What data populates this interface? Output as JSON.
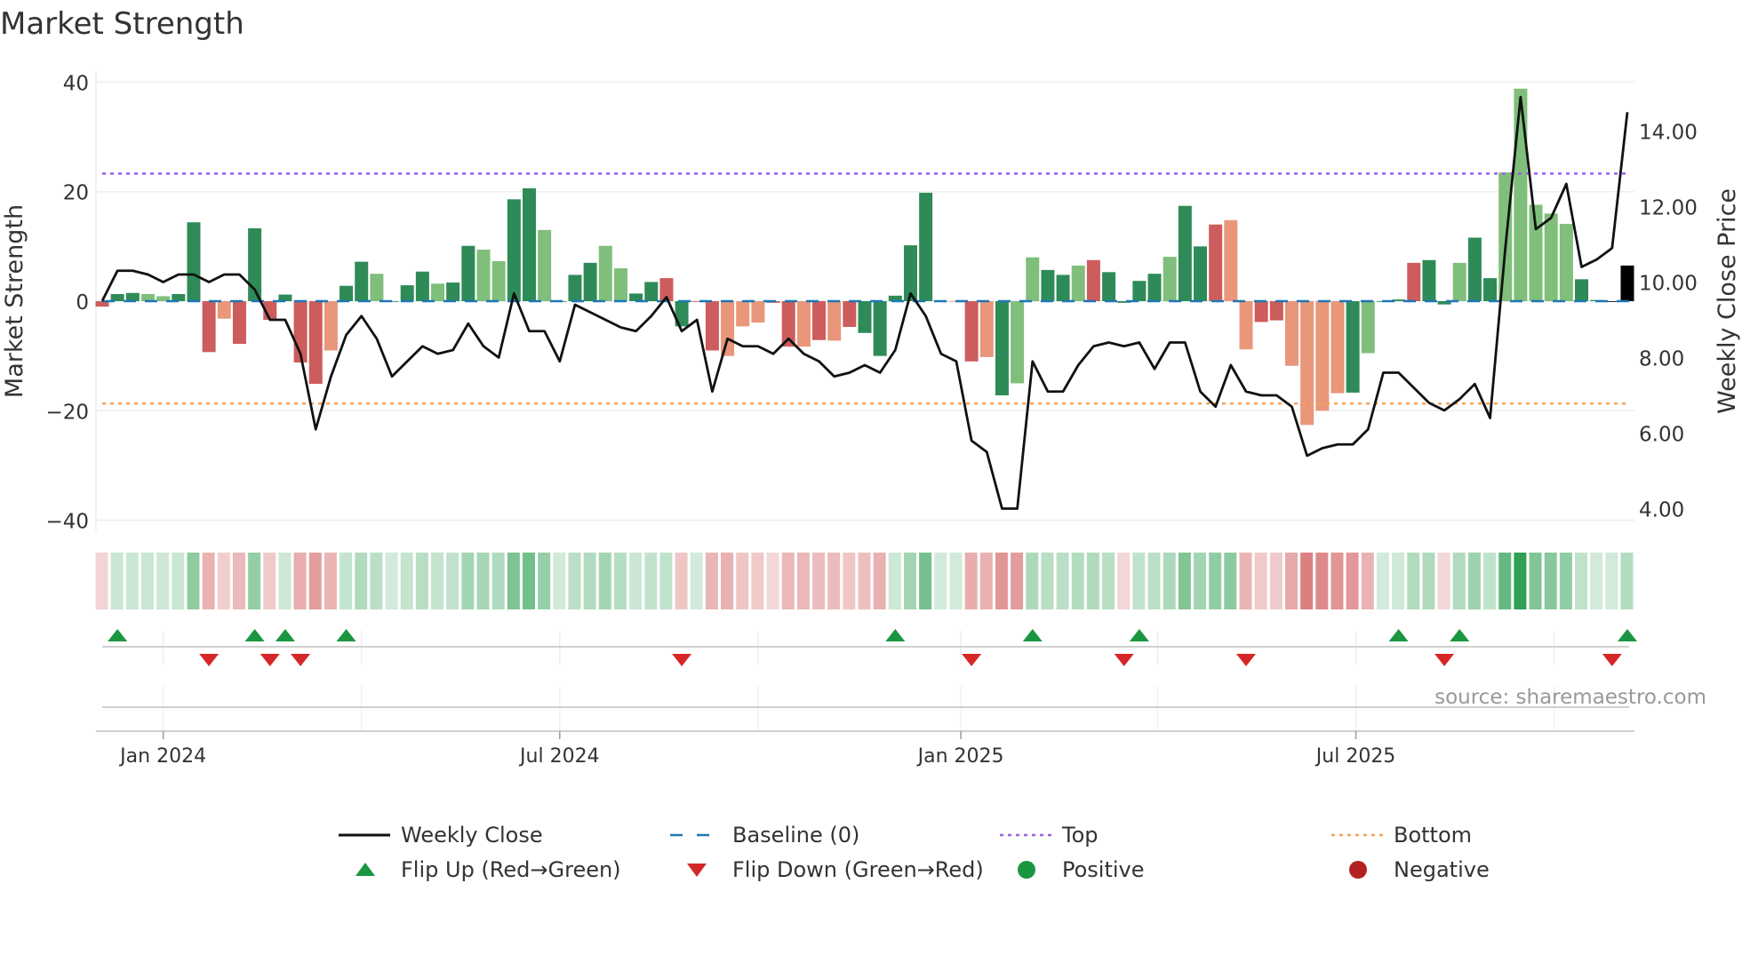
{
  "chart_data": {
    "type": "bar",
    "title": "Market Strength",
    "ylabel": "Market Strength",
    "y2label": "Weekly Close Price",
    "ylim": [
      -42,
      42
    ],
    "y2lim": [
      3.55,
      15.4
    ],
    "yticks": [
      40,
      20,
      0,
      -20,
      -40
    ],
    "yticklabels": [
      "40",
      "20",
      "0",
      "−20",
      "−40"
    ],
    "y2ticks": [
      14,
      12,
      10,
      8,
      6,
      4
    ],
    "y2ticklabels": [
      "14.00",
      "12.00",
      "10.00",
      "8.00",
      "6.00",
      "4.00"
    ],
    "xticks": [
      {
        "week": 4,
        "label": "Jan 2024"
      },
      {
        "week": 30,
        "label": "Jul 2024"
      },
      {
        "week": 56.3,
        "label": "Jan 2025"
      },
      {
        "week": 82.2,
        "label": "Jul 2025"
      }
    ],
    "quarter_gridlines_week": [
      4,
      17,
      30,
      43,
      56.3,
      69.2,
      82.2,
      95.2
    ],
    "top_level": 23.3,
    "bottom_level": -18.7,
    "baseline": 0,
    "strength": [
      -1,
      1.3,
      1.5,
      1.3,
      0.9,
      1.3,
      14.4,
      -9.3,
      -3.2,
      -7.8,
      13.3,
      -3.4,
      1.2,
      -11.2,
      -15.1,
      -9,
      2.8,
      7.2,
      5,
      0,
      2.9,
      5.4,
      3.2,
      3.4,
      10.1,
      9.4,
      7.3,
      18.6,
      20.6,
      13,
      0,
      4.8,
      7,
      10.1,
      6,
      1.4,
      3.5,
      4.2,
      -4.6,
      0,
      -9,
      -10,
      -4.6,
      -3.9,
      -0.3,
      -8.3,
      -8.3,
      -7.1,
      -7.2,
      -4.7,
      -5.8,
      -10,
      1,
      10.2,
      19.8,
      0,
      0,
      -11,
      -10.2,
      -17.2,
      -15,
      8,
      5.7,
      4.8,
      6.5,
      7.5,
      5.3,
      -0.3,
      3.7,
      5,
      8.1,
      17.4,
      10,
      14,
      14.8,
      -8.8,
      -3.8,
      -3.5,
      -11.8,
      -22.6,
      -20,
      -16.8,
      -16.7,
      -9.5,
      0,
      0.3,
      7,
      7.5,
      -0.6,
      7,
      11.6,
      4.2,
      23.5,
      38.8,
      17.6,
      16,
      14.1,
      4,
      0.2,
      0,
      6.5
    ],
    "bar_shade": "RGGggGGRrRGRGRRrGGgGGGgGGggGGgGGGggGGRGRRrrrRRrRrRGGGGGRrRrGggGGgRGGGGgGGRrrRRrrrrGgGGRGGgGGgggggGG",
    "weekly_close": [
      9.5,
      10.3,
      10.3,
      10.2,
      10.0,
      10.2,
      10.2,
      10.0,
      10.2,
      10.2,
      9.8,
      9.0,
      9.0,
      8.1,
      6.1,
      7.5,
      8.6,
      9.1,
      8.5,
      7.5,
      7.9,
      8.3,
      8.1,
      8.2,
      8.9,
      8.3,
      8.0,
      9.7,
      8.7,
      8.7,
      7.9,
      9.4,
      9.2,
      9.0,
      8.8,
      8.7,
      9.1,
      9.6,
      8.7,
      9.0,
      7.1,
      8.5,
      8.3,
      8.3,
      8.1,
      8.5,
      8.1,
      7.9,
      7.5,
      7.6,
      7.8,
      7.6,
      8.2,
      9.7,
      9.1,
      8.1,
      7.9,
      5.8,
      5.5,
      4.0,
      4.0,
      7.9,
      7.1,
      7.1,
      7.8,
      8.3,
      8.4,
      8.3,
      8.4,
      7.7,
      8.4,
      8.4,
      7.1,
      6.7,
      7.8,
      7.1,
      7.0,
      7.0,
      6.7,
      5.4,
      5.6,
      5.7,
      5.7,
      6.1,
      7.6,
      7.6,
      7.2,
      6.8,
      6.6,
      6.9,
      7.3,
      6.4,
      10.9,
      14.9,
      11.4,
      11.7,
      12.6,
      10.4,
      10.6,
      10.9,
      14.5
    ],
    "flip_up_weeks": [
      1,
      10,
      12,
      16,
      52,
      61,
      68,
      85,
      89,
      100
    ],
    "flip_down_weeks": [
      7,
      11,
      13,
      38,
      57,
      67,
      75,
      88,
      99
    ],
    "legend_position": "bottom",
    "legend": [
      {
        "label": "Weekly Close",
        "kind": "line"
      },
      {
        "label": "Baseline (0)",
        "kind": "dash"
      },
      {
        "label": "Top",
        "kind": "dot-purple"
      },
      {
        "label": "Bottom",
        "kind": "dot-orange"
      },
      {
        "label": "Flip Up (Red→Green)",
        "kind": "tri-up"
      },
      {
        "label": "Flip Down (Green→Red)",
        "kind": "tri-down"
      },
      {
        "label": "Positive",
        "kind": "circle-green"
      },
      {
        "label": "Negative",
        "kind": "circle-red"
      }
    ],
    "source": "source: sharemaestro.com"
  },
  "colors": {
    "dark_green": "#2e8b57",
    "light_green": "#7fbf7b",
    "red": "#cd5c5c",
    "salmon": "#e9967a",
    "top": "#9b5de5",
    "bottom": "#f4a259",
    "baseline": "#1f77b4",
    "flip_up": "#1a9641",
    "flip_down": "#d62728",
    "positive": "#1a9641",
    "negative": "#b22222"
  }
}
